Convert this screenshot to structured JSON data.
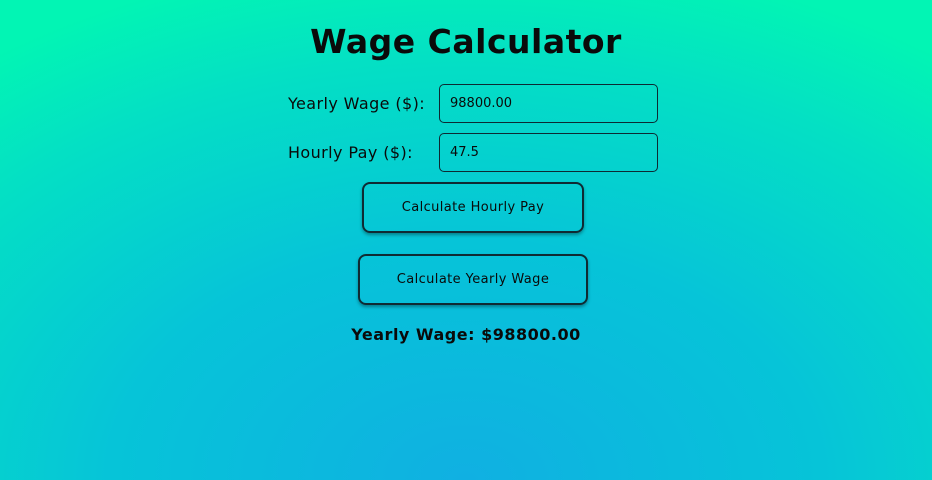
{
  "page": {
    "title": "Wage Calculator"
  },
  "form": {
    "yearly_wage_label": "Yearly Wage ($):",
    "yearly_wage_value": "98800.00",
    "hourly_pay_label": "Hourly Pay ($):",
    "hourly_pay_value": "47.5"
  },
  "buttons": {
    "calculate_hourly": "Calculate Hourly Pay",
    "calculate_yearly": "Calculate Yearly Wage"
  },
  "result": {
    "text": "Yearly Wage: $98800.00"
  },
  "colors": {
    "background_top": "#02f5b4",
    "background_bottom": "#10b0e2",
    "text": "#0a0a0a"
  }
}
